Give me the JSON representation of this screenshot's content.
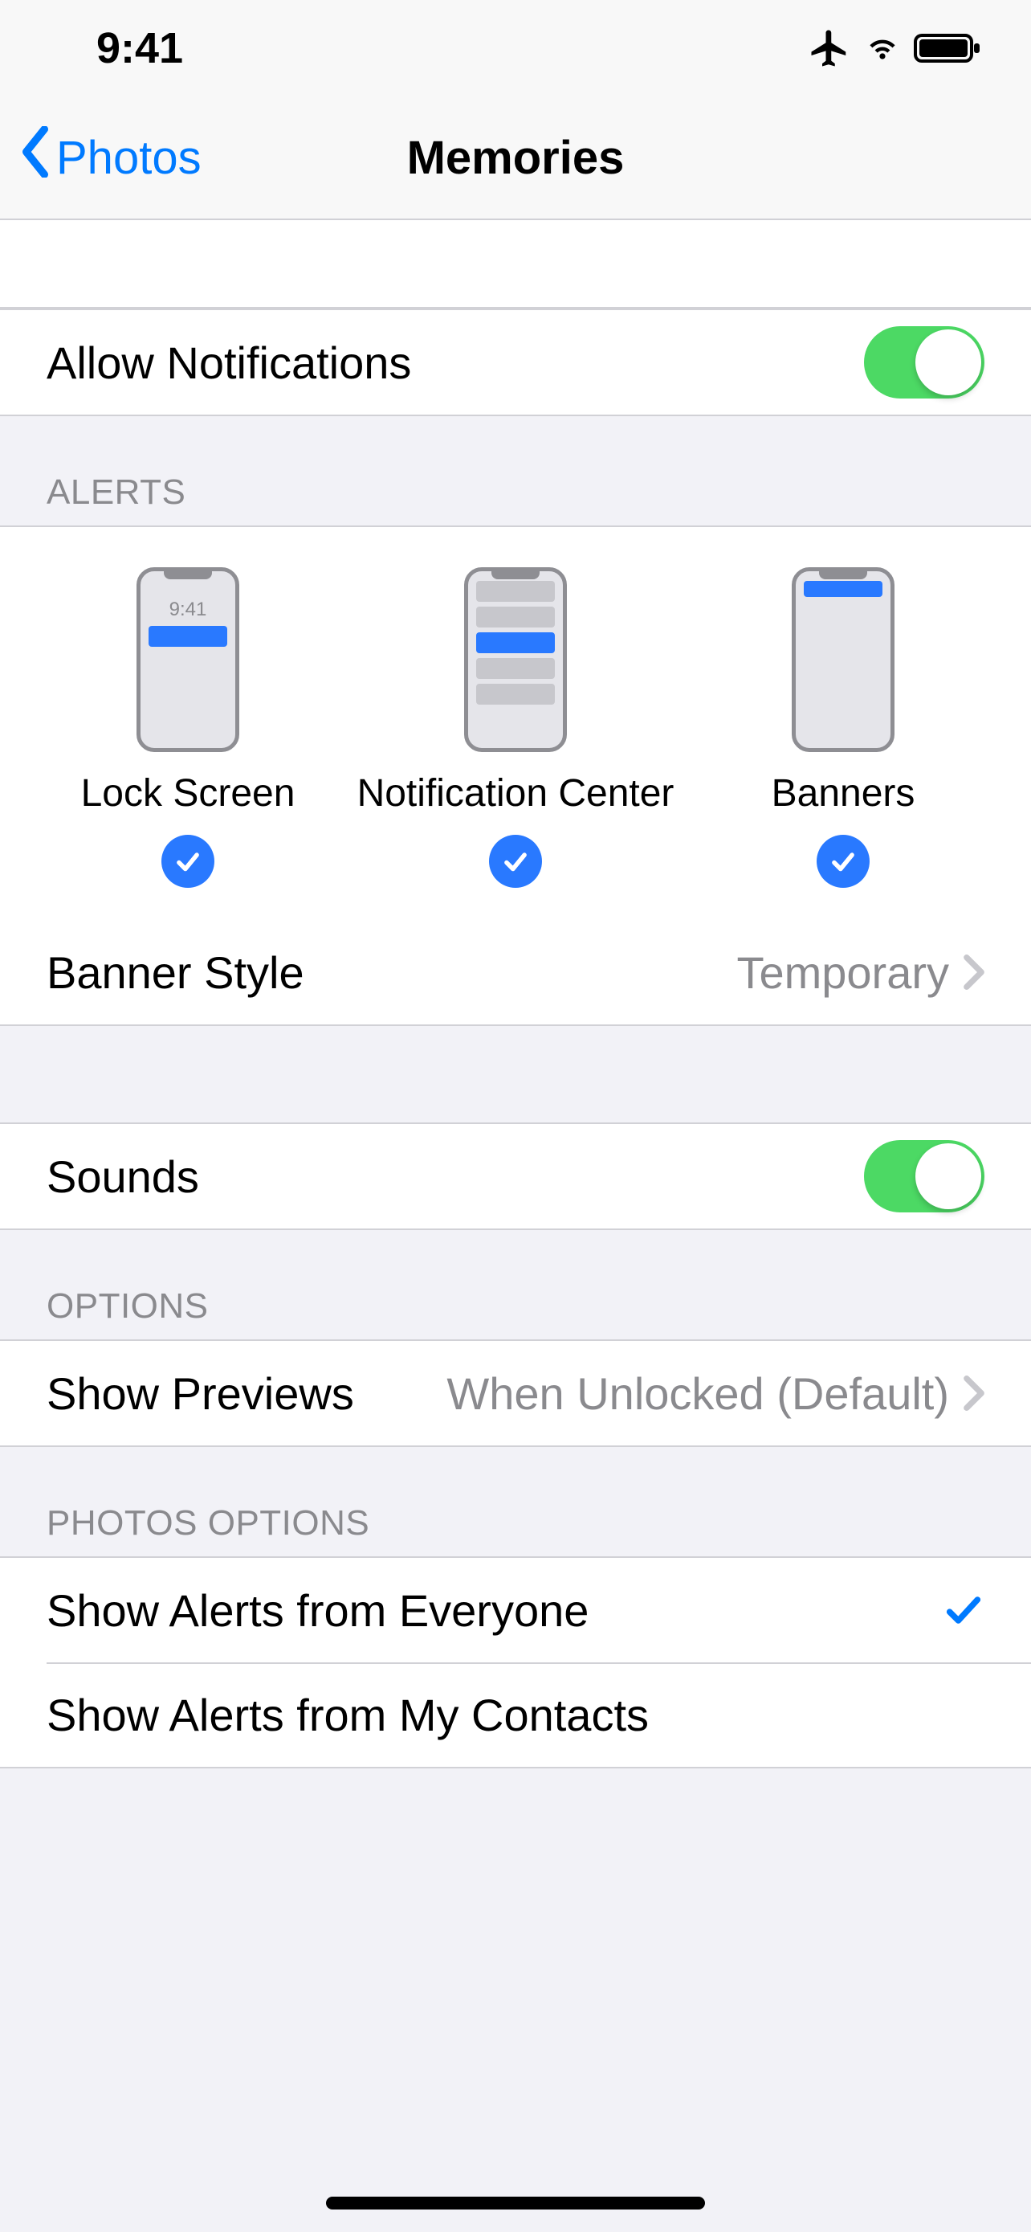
{
  "status": {
    "time": "9:41"
  },
  "nav": {
    "back_label": "Photos",
    "title": "Memories"
  },
  "allow": {
    "label": "Allow Notifications",
    "on": true
  },
  "alerts": {
    "header": "ALERTS",
    "types": [
      {
        "label": "Lock Screen",
        "checked": true
      },
      {
        "label": "Notification Center",
        "checked": true
      },
      {
        "label": "Banners",
        "checked": true
      }
    ],
    "lock_time": "9:41",
    "banner_style": {
      "label": "Banner Style",
      "value": "Temporary"
    }
  },
  "sounds": {
    "label": "Sounds",
    "on": true
  },
  "options": {
    "header": "OPTIONS",
    "previews": {
      "label": "Show Previews",
      "value": "When Unlocked (Default)"
    }
  },
  "photos_options": {
    "header": "PHOTOS OPTIONS",
    "items": [
      {
        "label": "Show Alerts from Everyone",
        "checked": true
      },
      {
        "label": "Show Alerts from My Contacts",
        "checked": false
      }
    ]
  }
}
